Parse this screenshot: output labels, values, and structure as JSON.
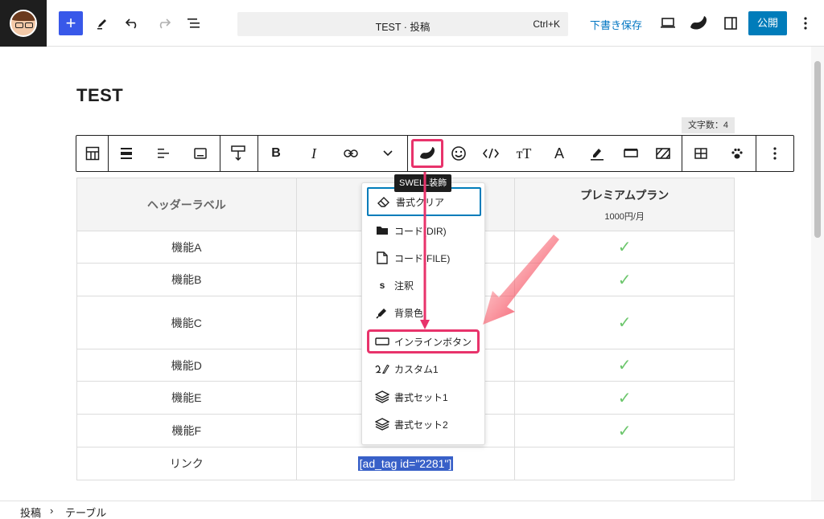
{
  "topbar": {
    "command_title": "TEST · 投稿",
    "command_shortcut": "Ctrl+K",
    "save_draft": "下書き保存",
    "publish": "公開"
  },
  "editor": {
    "post_title": "TEST",
    "char_count": "文字数：4",
    "tooltip": "SWELL装飾"
  },
  "table": {
    "header_label": "ヘッダーラベル",
    "plan_name": "プレミアムプラン",
    "plan_price": "1000円/月",
    "rows": [
      {
        "label": "機能A",
        "check": "✓"
      },
      {
        "label": "機能B",
        "check": "✓"
      },
      {
        "label": "機能C",
        "check": "✓"
      },
      {
        "label": "機能D",
        "check": "✓"
      },
      {
        "label": "機能E",
        "check": "✓"
      },
      {
        "label": "機能F",
        "check": "✓"
      }
    ],
    "link_label": "リンク",
    "link_value": "[ad_tag id=\"2281\"]"
  },
  "dropdown": {
    "items": [
      {
        "label": "書式クリア",
        "icon": "eraser-icon"
      },
      {
        "label": "コード(DIR)",
        "icon": "folder-icon"
      },
      {
        "label": "コード(FILE)",
        "icon": "file-icon"
      },
      {
        "label": "注釈",
        "icon": "s-icon"
      },
      {
        "label": "背景色",
        "icon": "marker-icon"
      },
      {
        "label": "インラインボタン",
        "icon": "button-icon"
      },
      {
        "label": "カスタム1",
        "icon": "custom-icon"
      },
      {
        "label": "書式セット1",
        "icon": "layers-icon"
      },
      {
        "label": "書式セット2",
        "icon": "layers-icon"
      }
    ]
  },
  "statusbar": {
    "crumb_1": "投稿",
    "separator": "›",
    "crumb_2": "テーブル"
  },
  "colors": {
    "accent": "#3858e9",
    "publish": "#007cba",
    "highlight": "#e8336b",
    "check": "#6cc66c"
  }
}
